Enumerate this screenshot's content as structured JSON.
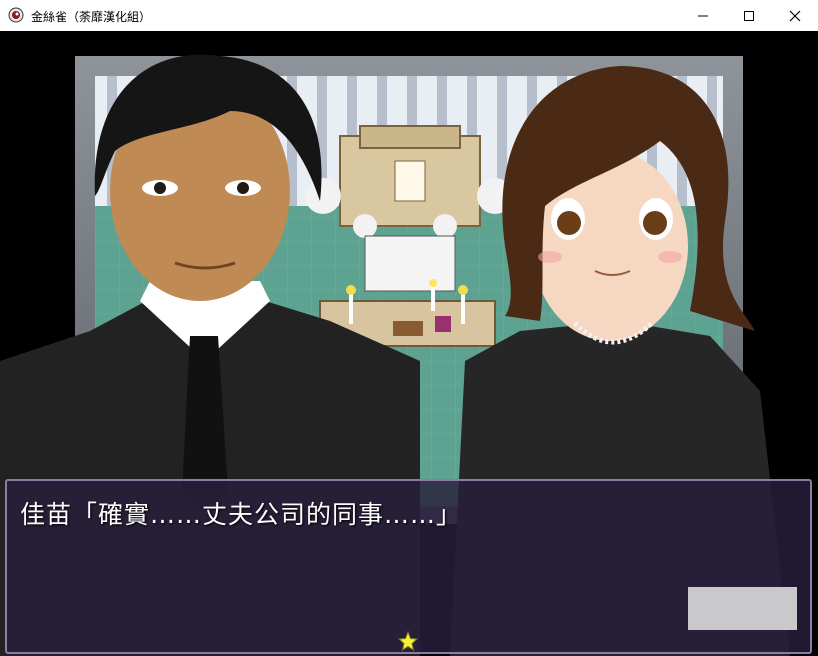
{
  "window": {
    "title": "金絲雀（荼靡漢化組）",
    "controls": {
      "minimize": "minimize-icon",
      "maximize": "maximize-icon",
      "close": "close-icon"
    }
  },
  "scene": {
    "setting": "funeral altar",
    "characters": [
      "man in black suit",
      "woman in black dress",
      "small sprites"
    ]
  },
  "dialog": {
    "text": "佳苗「確實……丈夫公司的同事……」"
  },
  "colors": {
    "dialog_bg": "#281e3c",
    "dialog_border": "#8d7aa6",
    "floor": "#5ea291"
  }
}
